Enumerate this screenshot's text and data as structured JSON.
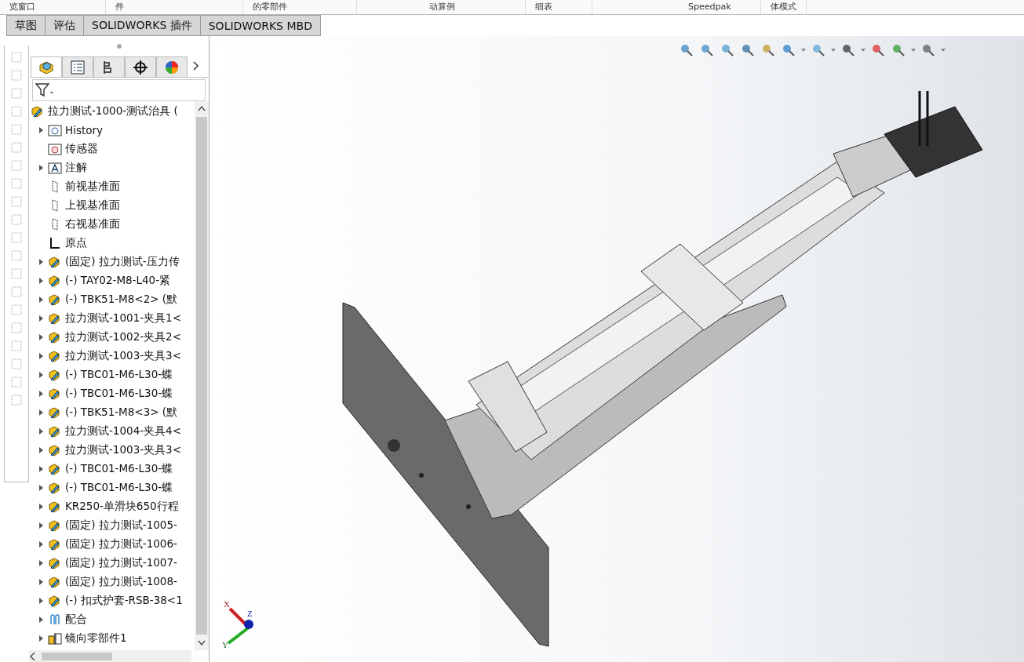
{
  "ribbon_fragments": [
    "览窗口",
    "件",
    "的零部件",
    "动算例",
    "细表",
    "Speedpak",
    "体模式"
  ],
  "tabs": [
    {
      "label": "草图",
      "selected": false
    },
    {
      "label": "评估",
      "selected": false
    },
    {
      "label": "SOLIDWORKS 插件",
      "selected": false
    },
    {
      "label": "SOLIDWORKS MBD",
      "selected": false
    }
  ],
  "manager_tabs": [
    {
      "kind": "feature",
      "selected": true
    },
    {
      "kind": "property",
      "selected": false
    },
    {
      "kind": "config",
      "selected": false
    },
    {
      "kind": "dimxpert",
      "selected": false
    },
    {
      "kind": "display",
      "selected": false
    }
  ],
  "tree": {
    "root": {
      "label": "拉力测试-1000-测试治具 (",
      "children": [
        {
          "kind": "history",
          "label": "History",
          "expandable": true
        },
        {
          "kind": "sensor",
          "label": "传感器",
          "expandable": false
        },
        {
          "kind": "annotation",
          "label": "注解",
          "expandable": true
        },
        {
          "kind": "plane",
          "label": "前视基准面",
          "expandable": false
        },
        {
          "kind": "plane",
          "label": "上视基准面",
          "expandable": false
        },
        {
          "kind": "plane",
          "label": "右视基准面",
          "expandable": false
        },
        {
          "kind": "origin",
          "label": "原点",
          "expandable": false
        },
        {
          "kind": "part",
          "label": "(固定) 拉力测试-压力传",
          "expandable": true
        },
        {
          "kind": "part",
          "label": "(-) TAY02-M8-L40-紧",
          "expandable": true
        },
        {
          "kind": "part",
          "label": "(-) TBK51-M8<2> (默",
          "expandable": true
        },
        {
          "kind": "part",
          "label": "拉力测试-1001-夹具1<",
          "expandable": true
        },
        {
          "kind": "part",
          "label": "拉力测试-1002-夹具2<",
          "expandable": true
        },
        {
          "kind": "part",
          "label": "拉力测试-1003-夹具3<",
          "expandable": true
        },
        {
          "kind": "part",
          "label": "(-) TBC01-M6-L30-蝶",
          "expandable": true
        },
        {
          "kind": "part",
          "label": "(-) TBC01-M6-L30-蝶",
          "expandable": true
        },
        {
          "kind": "part",
          "label": "(-) TBK51-M8<3> (默",
          "expandable": true
        },
        {
          "kind": "part",
          "label": "拉力测试-1004-夹具4<",
          "expandable": true
        },
        {
          "kind": "part",
          "label": "拉力测试-1003-夹具3<",
          "expandable": true
        },
        {
          "kind": "part",
          "label": "(-) TBC01-M6-L30-蝶",
          "expandable": true
        },
        {
          "kind": "part",
          "label": "(-) TBC01-M6-L30-蝶",
          "expandable": true
        },
        {
          "kind": "assembly",
          "label": "KR250-单滑块650行程",
          "expandable": true
        },
        {
          "kind": "part",
          "label": "(固定) 拉力测试-1005-",
          "expandable": true
        },
        {
          "kind": "part",
          "label": "(固定) 拉力测试-1006-",
          "expandable": true
        },
        {
          "kind": "part",
          "label": "(固定) 拉力测试-1007-",
          "expandable": true
        },
        {
          "kind": "part",
          "label": "(固定) 拉力测试-1008-",
          "expandable": true
        },
        {
          "kind": "part",
          "label": "(-) 扣式护套-RSB-38<1",
          "expandable": true
        },
        {
          "kind": "mates",
          "label": "配合",
          "expandable": true
        },
        {
          "kind": "mirror",
          "label": "镜向零部件1",
          "expandable": true
        }
      ]
    }
  },
  "axis_triad": {
    "x": "X",
    "y": "Y",
    "z": "Z"
  }
}
